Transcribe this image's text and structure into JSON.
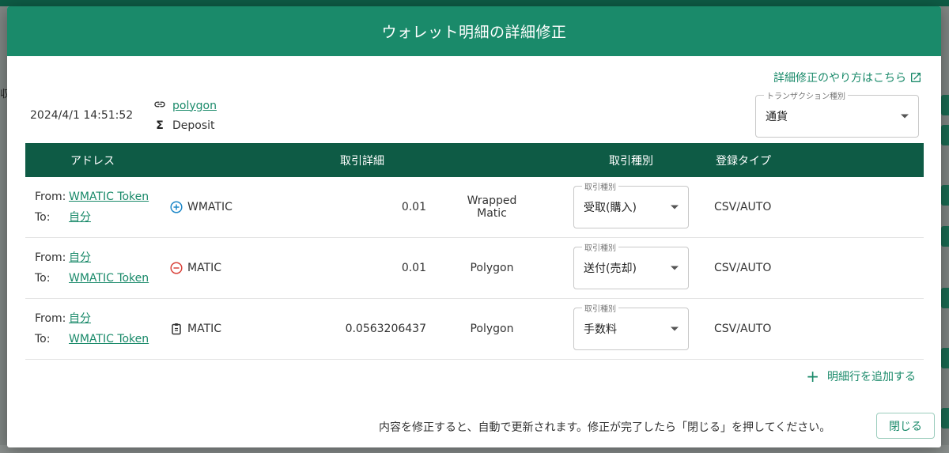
{
  "background": {
    "left_text": "収"
  },
  "modal": {
    "title": "ウォレット明細の詳細修正",
    "help_link": "詳細修正のやり方はこちら",
    "date": "2024/4/1 14:51:52",
    "network": "polygon",
    "category": "Deposit",
    "tx_type_label": "トランザクション種別",
    "tx_type_value": "通貨"
  },
  "table": {
    "headers": {
      "address": "アドレス",
      "detail": "取引詳細",
      "kind": "取引種別",
      "reg": "登録タイプ"
    },
    "select_label": "取引種別",
    "rows": [
      {
        "from_label": "From:",
        "from": "WMATIC Token",
        "to_label": "To:",
        "to": "自分",
        "token": "WMATIC",
        "amount": "0.01",
        "name": "Wrapped Matic",
        "kind": "受取(購入)",
        "reg": "CSV/AUTO"
      },
      {
        "from_label": "From:",
        "from": "自分",
        "to_label": "To:",
        "to": "WMATIC Token",
        "token": "MATIC",
        "amount": "0.01",
        "name": "Polygon",
        "kind": "送付(売却)",
        "reg": "CSV/AUTO"
      },
      {
        "from_label": "From:",
        "from": "自分",
        "to_label": "To:",
        "to": "WMATIC Token",
        "token": "MATIC",
        "amount": "0.0563206437",
        "name": "Polygon",
        "kind": "手数料",
        "reg": "CSV/AUTO"
      }
    ]
  },
  "add_row_label": "明細行を追加する",
  "footer_message": "内容を修正すると、自動で更新されます。修正が完了したら「閉じる」を押してください。",
  "close_label": "閉じる",
  "colors": {
    "header": "#1a8a6a",
    "table_head": "#0e5b45",
    "accent": "#1a8a6a",
    "plus": "#1e88c8",
    "minus": "#d9433b"
  }
}
